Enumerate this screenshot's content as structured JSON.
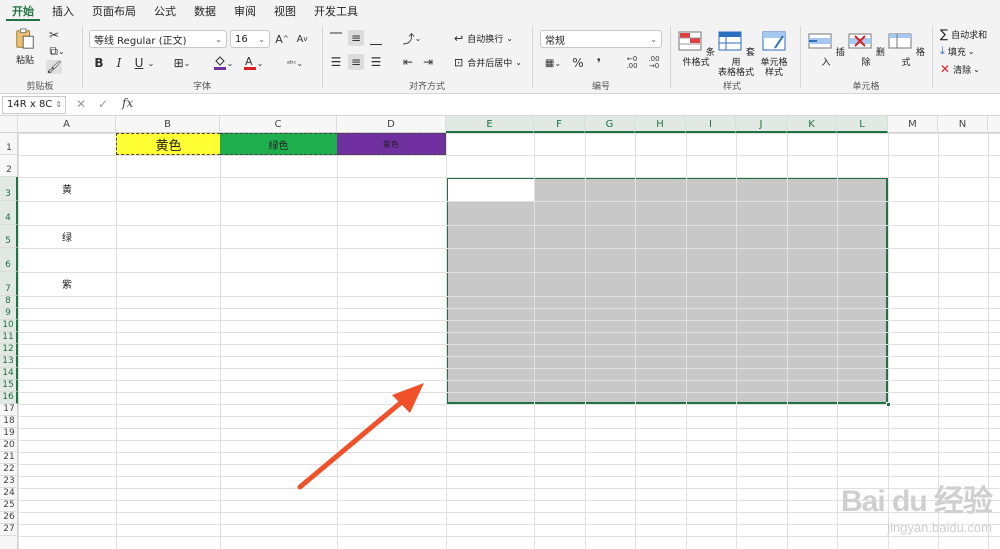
{
  "tabs": [
    "开始",
    "插入",
    "页面布局",
    "公式",
    "数据",
    "审阅",
    "视图",
    "开发工具"
  ],
  "ribbon": {
    "clipboard": {
      "paste": "粘贴",
      "label": "剪贴板"
    },
    "font": {
      "name": "等线 Regular (正文)",
      "size": "16",
      "bold": "B",
      "italic": "I",
      "underline": "U",
      "grow": "A",
      "shrink": "A",
      "label": "字体"
    },
    "alignment": {
      "wrap": "自动换行",
      "merge": "合并后居中",
      "label": "对齐方式"
    },
    "number": {
      "format": "常规",
      "percent": "%",
      "comma": "❜",
      "inc": "←0 .00",
      "dec": ".00 →0",
      "label": "编号"
    },
    "styles": {
      "conditional": "条件格式",
      "table_fmt_1": "套用",
      "table_fmt_2": "表格格式",
      "cell_style_1": "单元格",
      "cell_style_2": "样式",
      "label": "样式"
    },
    "cells": {
      "insert": "插入",
      "delete": "删除",
      "format": "格式",
      "label": "单元格"
    },
    "editing": {
      "autosum": "自动求和",
      "fill": "填充",
      "clear": "清除"
    }
  },
  "formula_bar": {
    "name_box": "14R x 8C",
    "fx": "fx",
    "content": ""
  },
  "sheet": {
    "columns": [
      "A",
      "B",
      "C",
      "D",
      "E",
      "F",
      "G",
      "H",
      "I",
      "J",
      "K",
      "L",
      "M",
      "N"
    ],
    "rows": [
      "1",
      "2",
      "3",
      "4",
      "5",
      "6",
      "7",
      "8",
      "9",
      "10",
      "11",
      "12",
      "13",
      "14",
      "15",
      "16",
      "17",
      "18",
      "19",
      "20",
      "21",
      "22",
      "23",
      "24",
      "25",
      "26",
      "27"
    ],
    "header_cells": [
      {
        "text": "黄色",
        "bg": "#ffff33"
      },
      {
        "text": "绿色",
        "bg": "#1eae4e"
      },
      {
        "text": "紫色",
        "bg": "#7030a0"
      }
    ],
    "row_labels": [
      "黄",
      "绿",
      "紫"
    ]
  },
  "colors": {
    "accent": "#217346",
    "selection_fill": "#c8c8c8",
    "arrow": "#f0512a"
  },
  "watermark": {
    "logo": "Bai du 经验",
    "url": "jingyan.baidu.com"
  }
}
